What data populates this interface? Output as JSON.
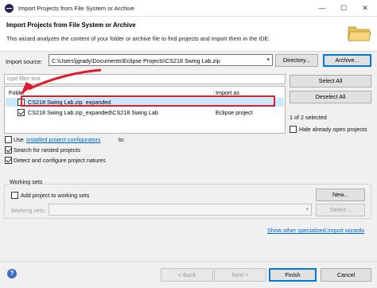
{
  "window": {
    "title": "Import Projects from File System or Archive",
    "minimize_glyph": "—",
    "maximize_glyph": "☐",
    "close_glyph": "✕"
  },
  "header": {
    "title": "Import Projects from File System or Archive",
    "description": "This wizard analyzes the content of your folder or archive file to find projects and import them in the IDE.",
    "icon": "folder-icon"
  },
  "source": {
    "label": "Import source:",
    "value": "C:\\Users\\jgrady\\Documents\\Eclipse Projects\\CS218 Swing Lab.zip",
    "directory_button": "Directory...",
    "archive_button": "Archive..."
  },
  "filter": {
    "placeholder": "type filter text"
  },
  "table": {
    "columns": [
      "Folder",
      "Import as"
    ],
    "rows": [
      {
        "folder": "CS218 Swing Lab.zip_expanded",
        "import_as": "",
        "checked": false,
        "selected": true
      },
      {
        "folder": "CS218 Swing Lab.zip_expanded\\CS218 Swing Lab",
        "import_as": "Eclipse project",
        "checked": true,
        "selected": false
      }
    ]
  },
  "side": {
    "select_all": "Select All",
    "deselect_all": "Deselect All",
    "selected_count": "1 of 2 selected",
    "hide_open_label": "Hide already open projects",
    "hide_open_checked": false
  },
  "options": {
    "use_prefix": "Use",
    "use_link": "installed project configurators",
    "use_suffix": "to:",
    "use_checked": false,
    "search_nested": "Search for nested projects",
    "search_nested_checked": true,
    "detect_configure": "Detect and configure project natures",
    "detect_configure_checked": true
  },
  "working_sets": {
    "title": "Working sets",
    "add_label": "Add project to working sets",
    "add_checked": false,
    "new_button": "New...",
    "sets_label": "Working sets:",
    "select_button": "Select..."
  },
  "show_specialized_link": "Show other specialized import wizards",
  "footer": {
    "help": "?",
    "back": "< Back",
    "next": "Next >",
    "finish": "Finish",
    "cancel": "Cancel"
  },
  "annotation": {
    "color": "#e01c2a"
  }
}
